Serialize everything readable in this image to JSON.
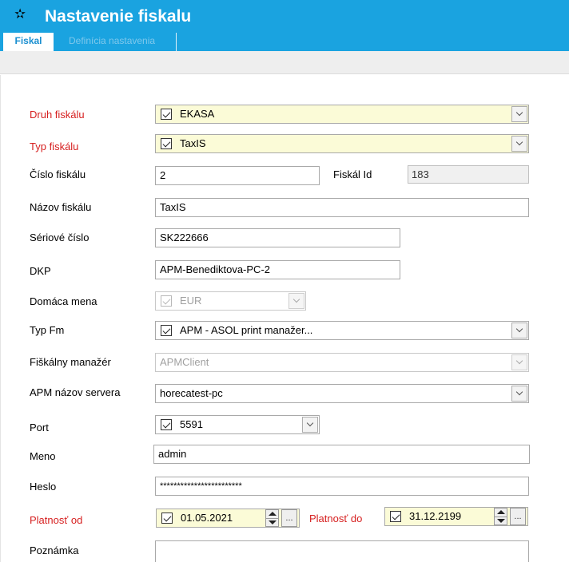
{
  "header": {
    "star_glyph": "✫",
    "title": "Nastavenie fiskalu",
    "tabs": [
      {
        "label": "Fiskal",
        "active": true
      },
      {
        "label": "Definícia nastavenia",
        "active": false
      }
    ]
  },
  "colors": {
    "header_bg": "#1aa3e0",
    "required_label": "#d61f1f",
    "highlight_field": "#fbfbd7"
  },
  "form": {
    "druh_fiskalu": {
      "label": "Druh fiskálu",
      "value": "EKASA"
    },
    "typ_fiskalu": {
      "label": "Typ fiskálu",
      "value": "TaxIS"
    },
    "cislo_fiskalu": {
      "label": "Číslo fiskálu",
      "value": "2"
    },
    "fiskal_id": {
      "label": "Fiskál Id",
      "value": "183"
    },
    "nazov_fiskalu": {
      "label": "Názov fiskálu",
      "value": "TaxIS"
    },
    "seriove_cislo": {
      "label": "Sériové číslo",
      "value": "SK222666"
    },
    "dkp": {
      "label": "DKP",
      "value": "APM-Benediktova-PC-2"
    },
    "domaca_mena": {
      "label": "Domáca mena",
      "value": "EUR"
    },
    "typ_fm": {
      "label": "Typ Fm",
      "value": "APM - ASOL print manažer..."
    },
    "fiskalny_manazer": {
      "label": "Fiškálny manažér",
      "value": "APMClient"
    },
    "apm_nazov_servera": {
      "label": "APM názov servera",
      "value": "horecatest-pc"
    },
    "port": {
      "label": "Port",
      "value": "5591"
    },
    "meno": {
      "label": "Meno",
      "value": "admin"
    },
    "heslo": {
      "label": "Heslo",
      "value": "************************"
    },
    "platnost_od": {
      "label": "Platnosť od",
      "value": "01.05.2021"
    },
    "platnost_do": {
      "label": "Platnosť do",
      "value": "31.12.2199"
    },
    "poznamka": {
      "label": "Poznámka",
      "value": ""
    },
    "ellipsis_label": "..."
  }
}
